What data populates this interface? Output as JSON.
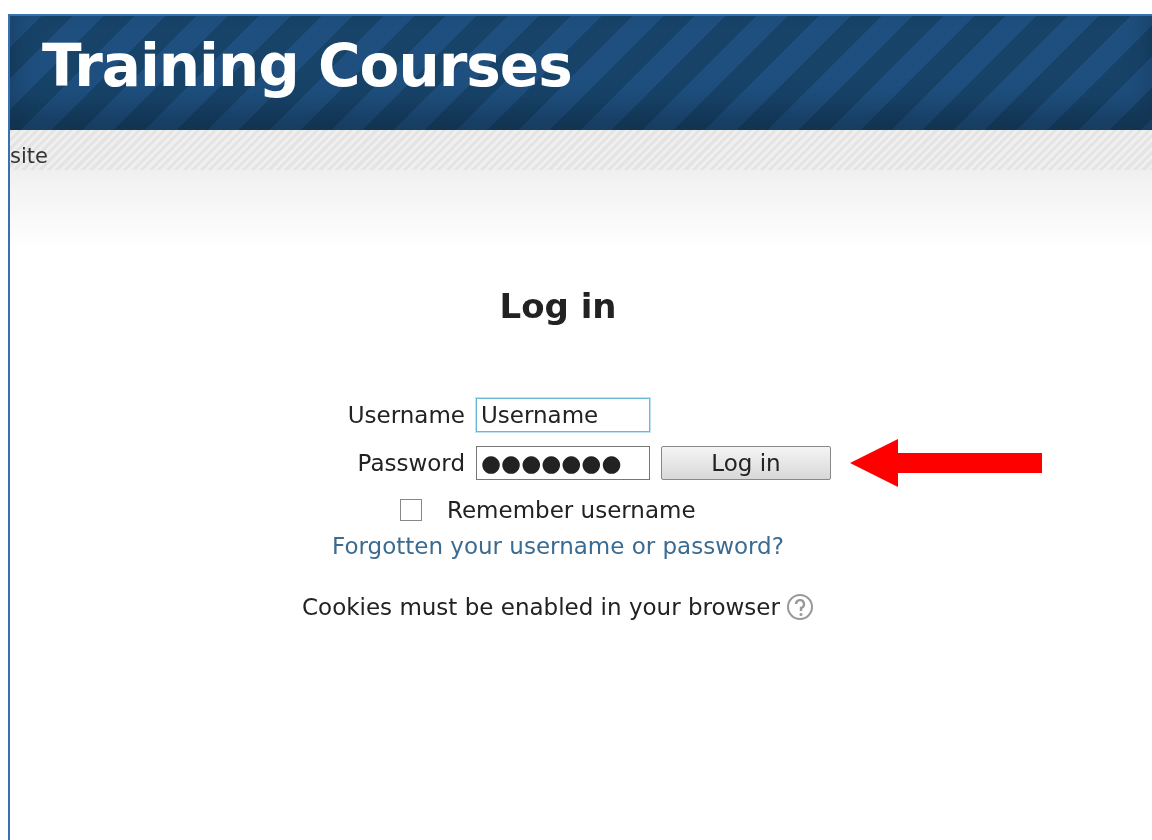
{
  "header": {
    "title": "Training Courses"
  },
  "breadcrumb": "site",
  "login": {
    "heading": "Log in",
    "fields": [
      {
        "label": "Username",
        "value": "Username",
        "focused": true
      },
      {
        "label": "Password",
        "value": "●●●●●●●",
        "focused": false
      }
    ],
    "button": "Log in",
    "remember": {
      "label": "Remember username",
      "checked": false
    },
    "forgot_link": "Forgotten your username or password?",
    "cookies_note": "Cookies must be enabled in your browser"
  }
}
